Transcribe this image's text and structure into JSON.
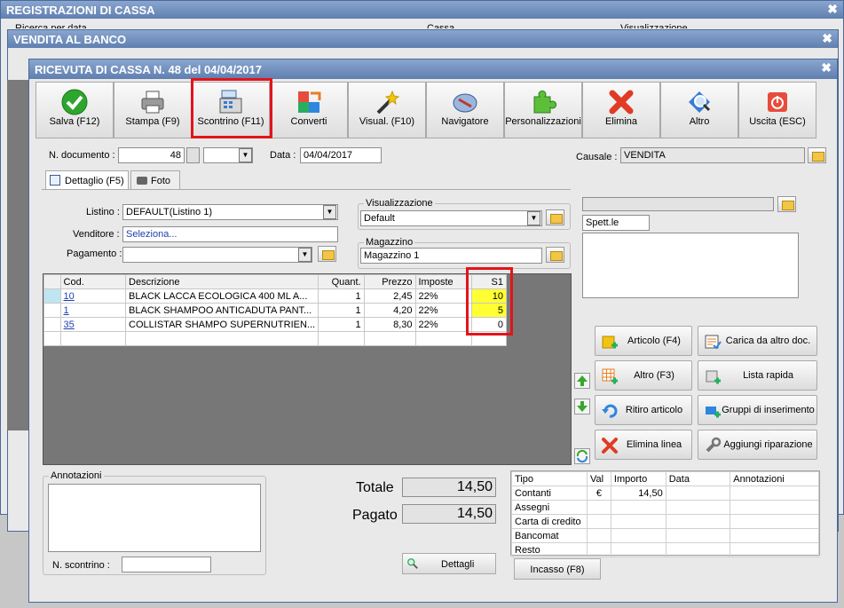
{
  "bg_windows": {
    "reg_title": "REGISTRAZIONI DI CASSA",
    "reg_sub1": "Ricerca per data",
    "reg_sub2": "Cassa",
    "reg_sub3": "Visualizzazione",
    "vendita_title": "VENDITA AL BANCO"
  },
  "window": {
    "title": "RICEVUTA DI CASSA N. 48 del 04/04/2017",
    "close": "✖"
  },
  "toolbar": [
    {
      "label": "Salva (F12)",
      "icon": "check-icon"
    },
    {
      "label": "Stampa (F9)",
      "icon": "printer-icon"
    },
    {
      "label": "Scontrino (F11)",
      "icon": "cash-register-icon"
    },
    {
      "label": "Converti",
      "icon": "convert-icon"
    },
    {
      "label": "Visual. (F10)",
      "icon": "magic-wand-icon"
    },
    {
      "label": "Navigatore",
      "icon": "compass-icon"
    },
    {
      "label": "Personalizzazioni",
      "icon": "puzzle-icon"
    },
    {
      "label": "Elimina",
      "icon": "delete-x-icon"
    },
    {
      "label": "Altro",
      "icon": "magnifier-icon"
    },
    {
      "label": "Uscita (ESC)",
      "icon": "power-icon"
    }
  ],
  "doc": {
    "num_label": "N. documento :",
    "num_value": "48",
    "data_label": "Data :",
    "data_value": "04/04/2017",
    "causale_label": "Causale :",
    "causale_value": "VENDITA"
  },
  "tabs": {
    "dettaglio": "Dettaglio (F5)",
    "foto": "Foto"
  },
  "form": {
    "listino_label": "Listino :",
    "listino_value": "DEFAULT(Listino 1)",
    "venditore_label": "Venditore :",
    "venditore_value": "Seleziona...",
    "pagamento_label": "Pagamento :",
    "pagamento_value": "",
    "visual_title": "Visualizzazione",
    "visual_value": "Default",
    "magazzino_title": "Magazzino",
    "magazzino_value": "Magazzino 1",
    "spett_value": "Spett.le"
  },
  "grid": {
    "headers": [
      "Cod.",
      "Descrizione",
      "Quant.",
      "Prezzo",
      "Imposte",
      "S1"
    ],
    "rows": [
      [
        "10",
        "BLACK LACCA ECOLOGICA 400 ML A...",
        "1",
        "2,45",
        "22%",
        "10"
      ],
      [
        "1",
        "BLACK SHAMPOO ANTICADUTA PANT...",
        "1",
        "4,20",
        "22%",
        "5"
      ],
      [
        "35",
        "COLLISTAR SHAMPO SUPERNUTRIEN...",
        "1",
        "8,30",
        "22%",
        "0"
      ]
    ]
  },
  "side_buttons": [
    {
      "label": "Articolo (F4)",
      "icon": "article-add-icon"
    },
    {
      "label": "Carica da altro doc.",
      "icon": "load-doc-icon"
    },
    {
      "label": "Altro (F3)",
      "icon": "grid-add-icon"
    },
    {
      "label": "Lista rapida",
      "icon": "quick-list-icon"
    },
    {
      "label": "Ritiro articolo",
      "icon": "undo-icon"
    },
    {
      "label": "Gruppi di inserimento",
      "icon": "group-insert-icon"
    },
    {
      "label": "Elimina linea",
      "icon": "delete-line-icon"
    },
    {
      "label": "Aggiungi riparazione",
      "icon": "wrench-icon"
    }
  ],
  "bottom": {
    "annotazioni_title": "Annotazioni",
    "scontrino_label": "N. scontrino :",
    "totale_label": "Totale",
    "totale_value": "14,50",
    "pagato_label": "Pagato",
    "pagato_value": "14,50",
    "dettagli_label": "Dettagli",
    "incasso_label": "Incasso (F8)"
  },
  "payments": {
    "headers": [
      "Tipo",
      "Val",
      "Importo",
      "Data",
      "Annotazioni"
    ],
    "rows": [
      [
        "Contanti",
        "€",
        "14,50",
        "",
        ""
      ],
      [
        "Assegni",
        "",
        "",
        "",
        ""
      ],
      [
        "Carta di credito",
        "",
        "",
        "",
        ""
      ],
      [
        "Bancomat",
        "",
        "",
        "",
        ""
      ],
      [
        "Resto",
        "",
        "",
        "",
        ""
      ]
    ]
  },
  "colors": {
    "highlight": "#e2141a",
    "stock_yellow": "#ffff33",
    "title_blue": "#6584b6"
  }
}
